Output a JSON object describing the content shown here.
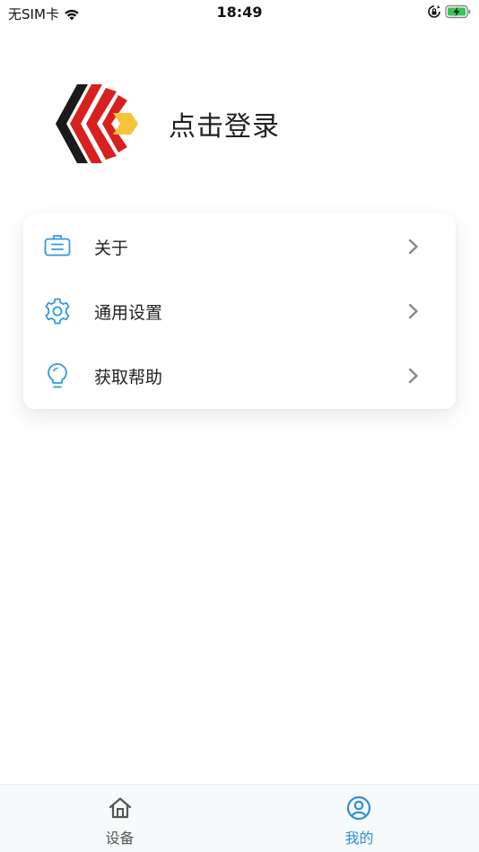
{
  "status_bar": {
    "carrier": "无SIM卡",
    "time": "18:49"
  },
  "profile": {
    "login_text": "点击登录"
  },
  "menu": {
    "items": [
      {
        "label": "关于",
        "icon": "about-icon"
      },
      {
        "label": "通用设置",
        "icon": "gear-icon"
      },
      {
        "label": "获取帮助",
        "icon": "lightbulb-icon"
      }
    ]
  },
  "tab_bar": {
    "tabs": [
      {
        "label": "设备",
        "icon": "home-icon",
        "active": false
      },
      {
        "label": "我的",
        "icon": "user-icon",
        "active": true
      }
    ]
  },
  "colors": {
    "accent": "#2e8fd6",
    "icon_blue": "#2f9bdc",
    "inactive_tab": "#555555",
    "logo_red": "#d8201e",
    "logo_yellow": "#f7c338",
    "logo_black": "#1a1a1a"
  }
}
